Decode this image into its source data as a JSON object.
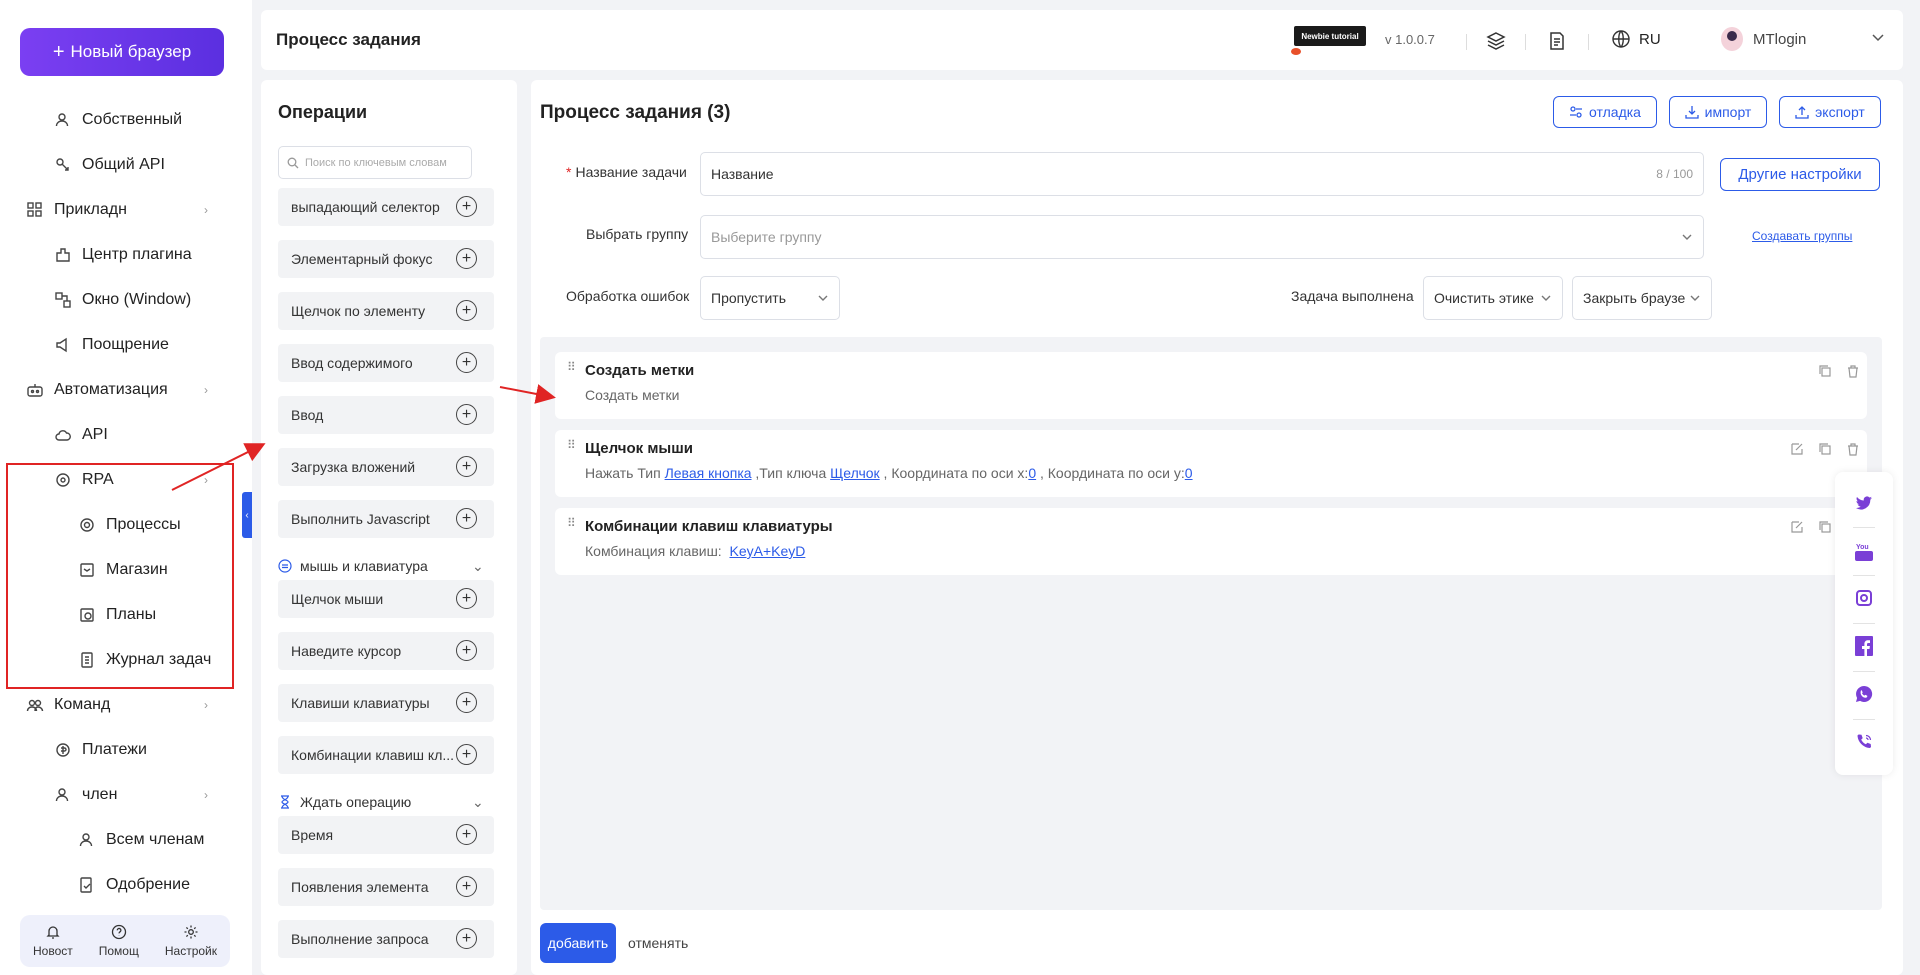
{
  "sidebar": {
    "new_browser": "Новый браузер",
    "items": [
      {
        "label": "Собственный",
        "icon": "user-icon"
      },
      {
        "label": "Общий API",
        "icon": "share-icon"
      },
      {
        "label": "Прикладн",
        "icon": "apps-icon"
      },
      {
        "label": "Центр плагина",
        "icon": "plugin-icon"
      },
      {
        "label": "Окно (Window)",
        "icon": "window-icon"
      },
      {
        "label": "Поощрение",
        "icon": "megaphone-icon"
      },
      {
        "label": "Автоматизация",
        "icon": "robot-icon"
      },
      {
        "label": "API",
        "icon": "cloud-icon"
      },
      {
        "label": "RPA",
        "icon": "rpa-icon"
      },
      {
        "label": "Процессы",
        "icon": "process-icon"
      },
      {
        "label": "Магазин",
        "icon": "store-icon"
      },
      {
        "label": "Планы",
        "icon": "plan-icon"
      },
      {
        "label": "Журнал задач",
        "icon": "log-icon"
      },
      {
        "label": "Команд",
        "icon": "team-icon"
      },
      {
        "label": "Платежи",
        "icon": "payment-icon"
      },
      {
        "label": "член",
        "icon": "member-icon"
      },
      {
        "label": "Всем членам",
        "icon": "members-icon"
      },
      {
        "label": "Одобрение",
        "icon": "approval-icon"
      }
    ],
    "bottom": {
      "news": "Новост",
      "help": "Помощ",
      "settings": "Настройк"
    }
  },
  "header": {
    "title": "Процесс задания",
    "newbie": "Newbie tutorial",
    "version": "v 1.0.0.7",
    "language": "RU",
    "user": "MTlogin"
  },
  "operations": {
    "title": "Операции",
    "search_placeholder": "Поиск по ключевым словам",
    "items_top": [
      "выпадающий селектор",
      "Элементарный фокус",
      "Щелчок по элементу",
      "Ввод содержимого",
      "Ввод",
      "Загрузка вложений",
      "Выполнить Javascript"
    ],
    "section_mouse": "мышь и клавиатура",
    "items_mouse": [
      "Щелчок мыши",
      "Наведите курсор",
      "Клавиши клавиатуры",
      "Комбинации клавиш кл..."
    ],
    "section_wait": "Ждать операцию",
    "items_wait": [
      "Время",
      "Появления элемента",
      "Выполнение запроса"
    ]
  },
  "main": {
    "title": "Процесс задания (3)",
    "btn_debug": "отладка",
    "btn_import": "импорт",
    "btn_export": "экспорт",
    "task_name_label": "Название задачи",
    "task_name_value": "Название",
    "task_name_counter": "8 / 100",
    "other_settings": "Другие настройки",
    "group_label": "Выбрать группу",
    "group_placeholder": "Выберите группу",
    "create_groups": "Создавать группы",
    "error_label": "Обработка ошибок",
    "error_value": "Пропустить",
    "done_label": "Задача выполнена",
    "done_value1": "Очистить этике",
    "done_value2": "Закрыть браузе",
    "steps": [
      {
        "title": "Создать метки",
        "desc": "Создать метки"
      },
      {
        "title": "Щелчок мыши",
        "desc_prefix": "Нажать Тип ",
        "link1": "Левая кнопка",
        "mid1": " ,Тип ключа ",
        "link2": "Щелчок",
        "mid2": " , Координата по оси х:",
        "link3": "0",
        "mid3": " , Координата по оси y:",
        "link4": "0"
      },
      {
        "title": "Комбинации клавиш клавиатуры",
        "desc_prefix": "Комбинация клавиш:  ",
        "link1": "KeyA+KeyD"
      }
    ],
    "add": "добавить",
    "cancel": "отменять"
  },
  "social": [
    "twitter-icon",
    "youtube-icon",
    "instagram-icon",
    "facebook-icon",
    "whatsapp-icon",
    "phone-icon"
  ],
  "colors": {
    "accent": "#2c5be8",
    "brand_purple": "#6a35ea",
    "highlight": "#e02424"
  }
}
